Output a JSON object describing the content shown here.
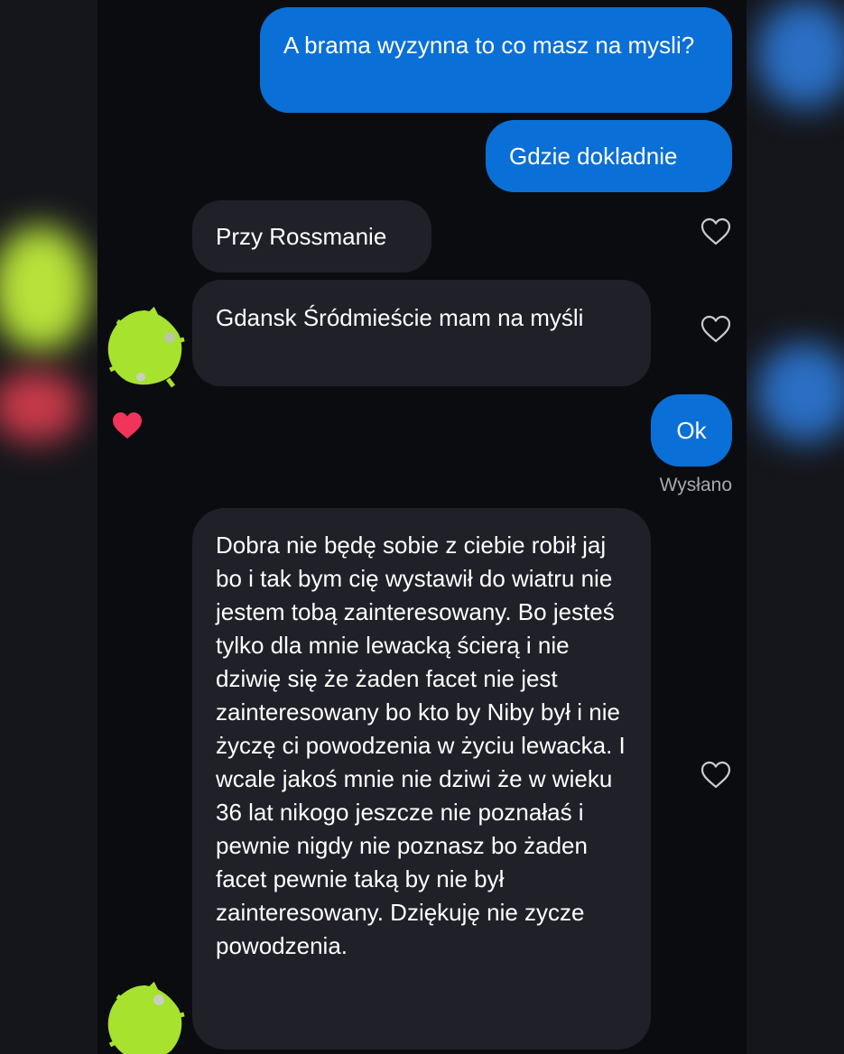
{
  "colors": {
    "outgoing_bubble": "#0a6fd6",
    "incoming_bubble": "#1f2028",
    "background": "#0b0c10",
    "reaction_heart": "#f0345a",
    "avatar_blur": "#a6e22e"
  },
  "messages": [
    {
      "direction": "outgoing",
      "text": "A brama wyzynna to co masz na mysli?"
    },
    {
      "direction": "outgoing",
      "text": "Gdzie dokladnie"
    },
    {
      "direction": "incoming",
      "text": "Przy Rossmanie"
    },
    {
      "direction": "incoming",
      "text": "Gdansk Śródmieście mam na myśli"
    },
    {
      "direction": "outgoing",
      "text": "Ok",
      "status": "Wysłano"
    },
    {
      "direction": "incoming",
      "text": "Dobra nie będę sobie z ciebie robił jaj bo i tak bym cię wystawił do wiatru nie jestem tobą zainteresowany. Bo jesteś tylko dla mnie lewacką ścierą i nie dziwię się że żaden facet nie jest zainteresowany bo kto by Niby był i nie życzę ci powodzenia w życiu lewacka. I wcale jakoś mnie nie dziwi że w wieku 36 lat nikogo jeszcze nie poznałaś i pewnie nigdy nie poznasz bo żaden facet pewnie taką by nie był zainteresowany. Dziękuję nie zycze powodzenia."
    }
  ],
  "icons": {
    "like": "heart-outline-icon",
    "reaction": "heart-filled-icon"
  }
}
